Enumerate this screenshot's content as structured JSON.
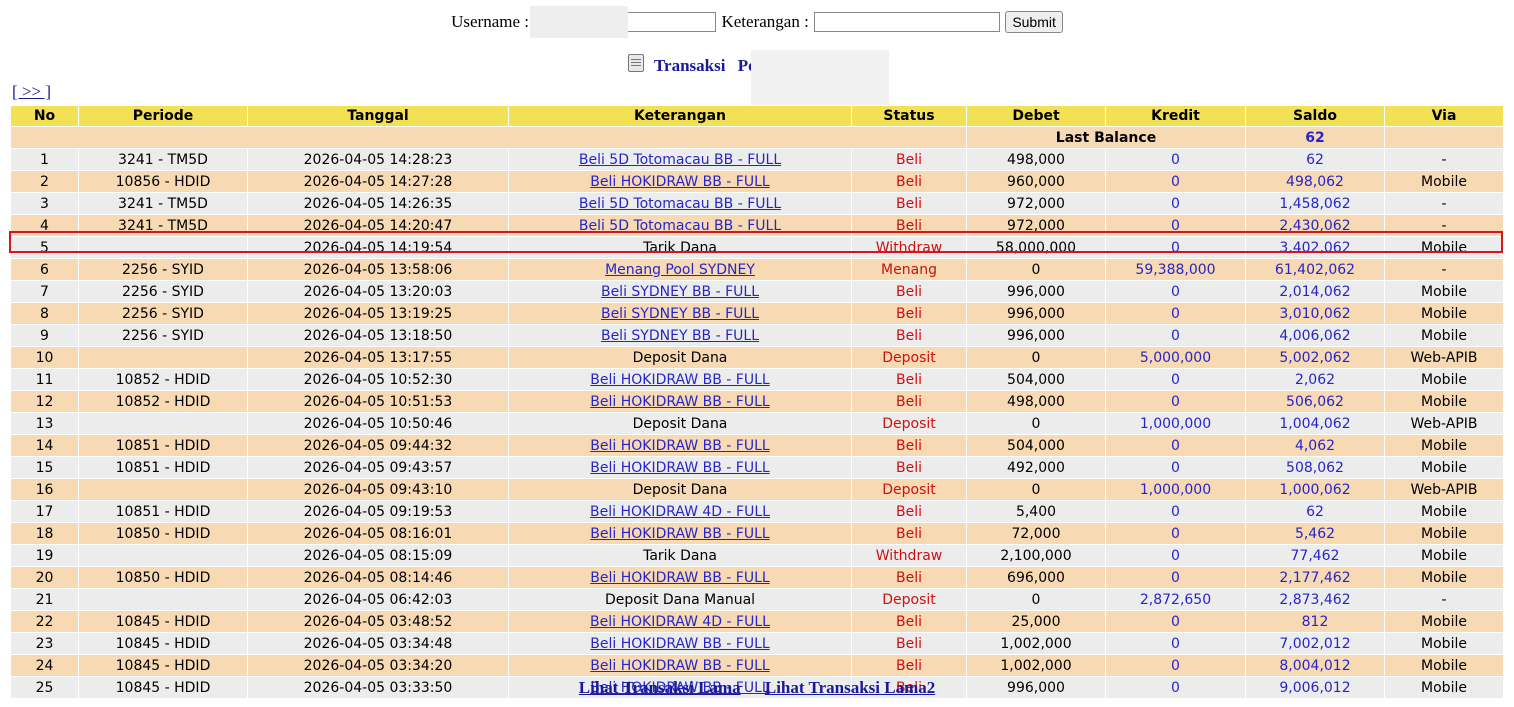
{
  "form": {
    "username_label": "Username :",
    "username_value": "",
    "keterangan_label": "Keterangan :",
    "keterangan_value": "",
    "submit_label": "Submit"
  },
  "title": {
    "transaksi": "Transaksi",
    "second": "Pe"
  },
  "nav": {
    "next": "[ >> ]"
  },
  "columns": [
    "No",
    "Periode",
    "Tanggal",
    "Keterangan",
    "Status",
    "Debet",
    "Kredit",
    "Saldo",
    "Via"
  ],
  "last_balance": {
    "label": "Last Balance",
    "value": "62"
  },
  "rows": [
    {
      "no": "1",
      "periode": "3241 - TM5D",
      "tanggal": "2026-04-05 14:28:23",
      "keterangan": "Beli 5D Totomacau BB - FULL",
      "link": true,
      "status": "Beli",
      "debet": "498,000",
      "kredit": "0",
      "saldo": "62",
      "via": "-"
    },
    {
      "no": "2",
      "periode": "10856 - HDID",
      "tanggal": "2026-04-05 14:27:28",
      "keterangan": "Beli HOKIDRAW BB - FULL",
      "link": true,
      "status": "Beli",
      "debet": "960,000",
      "kredit": "0",
      "saldo": "498,062",
      "via": "Mobile"
    },
    {
      "no": "3",
      "periode": "3241 - TM5D",
      "tanggal": "2026-04-05 14:26:35",
      "keterangan": "Beli 5D Totomacau BB - FULL",
      "link": true,
      "status": "Beli",
      "debet": "972,000",
      "kredit": "0",
      "saldo": "1,458,062",
      "via": "-"
    },
    {
      "no": "4",
      "periode": "3241 - TM5D",
      "tanggal": "2026-04-05 14:20:47",
      "keterangan": "Beli 5D Totomacau BB - FULL",
      "link": true,
      "status": "Beli",
      "debet": "972,000",
      "kredit": "0",
      "saldo": "2,430,062",
      "via": "-"
    },
    {
      "no": "5",
      "periode": "",
      "tanggal": "2026-04-05 14:19:54",
      "keterangan": "Tarik Dana",
      "link": false,
      "status": "Withdraw",
      "debet": "58,000,000",
      "kredit": "0",
      "saldo": "3,402,062",
      "via": "Mobile"
    },
    {
      "no": "6",
      "periode": "2256 - SYID",
      "tanggal": "2026-04-05 13:58:06",
      "keterangan": "Menang Pool SYDNEY",
      "link": true,
      "status": "Menang",
      "debet": "0",
      "kredit": "59,388,000",
      "saldo": "61,402,062",
      "via": "-"
    },
    {
      "no": "7",
      "periode": "2256 - SYID",
      "tanggal": "2026-04-05 13:20:03",
      "keterangan": "Beli SYDNEY BB - FULL",
      "link": true,
      "status": "Beli",
      "debet": "996,000",
      "kredit": "0",
      "saldo": "2,014,062",
      "via": "Mobile"
    },
    {
      "no": "8",
      "periode": "2256 - SYID",
      "tanggal": "2026-04-05 13:19:25",
      "keterangan": "Beli SYDNEY BB - FULL",
      "link": true,
      "status": "Beli",
      "debet": "996,000",
      "kredit": "0",
      "saldo": "3,010,062",
      "via": "Mobile"
    },
    {
      "no": "9",
      "periode": "2256 - SYID",
      "tanggal": "2026-04-05 13:18:50",
      "keterangan": "Beli SYDNEY BB - FULL",
      "link": true,
      "status": "Beli",
      "debet": "996,000",
      "kredit": "0",
      "saldo": "4,006,062",
      "via": "Mobile"
    },
    {
      "no": "10",
      "periode": "",
      "tanggal": "2026-04-05 13:17:55",
      "keterangan": "Deposit Dana",
      "link": false,
      "status": "Deposit",
      "debet": "0",
      "kredit": "5,000,000",
      "saldo": "5,002,062",
      "via": "Web-APIB"
    },
    {
      "no": "11",
      "periode": "10852 - HDID",
      "tanggal": "2026-04-05 10:52:30",
      "keterangan": "Beli HOKIDRAW BB - FULL",
      "link": true,
      "status": "Beli",
      "debet": "504,000",
      "kredit": "0",
      "saldo": "2,062",
      "via": "Mobile"
    },
    {
      "no": "12",
      "periode": "10852 - HDID",
      "tanggal": "2026-04-05 10:51:53",
      "keterangan": "Beli HOKIDRAW BB - FULL",
      "link": true,
      "status": "Beli",
      "debet": "498,000",
      "kredit": "0",
      "saldo": "506,062",
      "via": "Mobile"
    },
    {
      "no": "13",
      "periode": "",
      "tanggal": "2026-04-05 10:50:46",
      "keterangan": "Deposit Dana",
      "link": false,
      "status": "Deposit",
      "debet": "0",
      "kredit": "1,000,000",
      "saldo": "1,004,062",
      "via": "Web-APIB"
    },
    {
      "no": "14",
      "periode": "10851 - HDID",
      "tanggal": "2026-04-05 09:44:32",
      "keterangan": "Beli HOKIDRAW BB - FULL",
      "link": true,
      "status": "Beli",
      "debet": "504,000",
      "kredit": "0",
      "saldo": "4,062",
      "via": "Mobile"
    },
    {
      "no": "15",
      "periode": "10851 - HDID",
      "tanggal": "2026-04-05 09:43:57",
      "keterangan": "Beli HOKIDRAW BB - FULL",
      "link": true,
      "status": "Beli",
      "debet": "492,000",
      "kredit": "0",
      "saldo": "508,062",
      "via": "Mobile"
    },
    {
      "no": "16",
      "periode": "",
      "tanggal": "2026-04-05 09:43:10",
      "keterangan": "Deposit Dana",
      "link": false,
      "status": "Deposit",
      "debet": "0",
      "kredit": "1,000,000",
      "saldo": "1,000,062",
      "via": "Web-APIB"
    },
    {
      "no": "17",
      "periode": "10851 - HDID",
      "tanggal": "2026-04-05 09:19:53",
      "keterangan": "Beli HOKIDRAW 4D - FULL",
      "link": true,
      "status": "Beli",
      "debet": "5,400",
      "kredit": "0",
      "saldo": "62",
      "via": "Mobile"
    },
    {
      "no": "18",
      "periode": "10850 - HDID",
      "tanggal": "2026-04-05 08:16:01",
      "keterangan": "Beli HOKIDRAW BB - FULL",
      "link": true,
      "status": "Beli",
      "debet": "72,000",
      "kredit": "0",
      "saldo": "5,462",
      "via": "Mobile"
    },
    {
      "no": "19",
      "periode": "",
      "tanggal": "2026-04-05 08:15:09",
      "keterangan": "Tarik Dana",
      "link": false,
      "status": "Withdraw",
      "debet": "2,100,000",
      "kredit": "0",
      "saldo": "77,462",
      "via": "Mobile"
    },
    {
      "no": "20",
      "periode": "10850 - HDID",
      "tanggal": "2026-04-05 08:14:46",
      "keterangan": "Beli HOKIDRAW BB - FULL",
      "link": true,
      "status": "Beli",
      "debet": "696,000",
      "kredit": "0",
      "saldo": "2,177,462",
      "via": "Mobile"
    },
    {
      "no": "21",
      "periode": "",
      "tanggal": "2026-04-05 06:42:03",
      "keterangan": "Deposit Dana Manual",
      "link": false,
      "status": "Deposit",
      "debet": "0",
      "kredit": "2,872,650",
      "saldo": "2,873,462",
      "via": "-"
    },
    {
      "no": "22",
      "periode": "10845 - HDID",
      "tanggal": "2026-04-05 03:48:52",
      "keterangan": "Beli HOKIDRAW 4D - FULL",
      "link": true,
      "status": "Beli",
      "debet": "25,000",
      "kredit": "0",
      "saldo": "812",
      "via": "Mobile"
    },
    {
      "no": "23",
      "periode": "10845 - HDID",
      "tanggal": "2026-04-05 03:34:48",
      "keterangan": "Beli HOKIDRAW BB - FULL",
      "link": true,
      "status": "Beli",
      "debet": "1,002,000",
      "kredit": "0",
      "saldo": "7,002,012",
      "via": "Mobile"
    },
    {
      "no": "24",
      "periode": "10845 - HDID",
      "tanggal": "2026-04-05 03:34:20",
      "keterangan": "Beli HOKIDRAW BB - FULL",
      "link": true,
      "status": "Beli",
      "debet": "1,002,000",
      "kredit": "0",
      "saldo": "8,004,012",
      "via": "Mobile"
    },
    {
      "no": "25",
      "periode": "10845 - HDID",
      "tanggal": "2026-04-05 03:33:50",
      "keterangan": "Beli HOKIDRAW BB - FULL",
      "link": true,
      "status": "Beli",
      "debet": "996,000",
      "kredit": "0",
      "saldo": "9,006,012",
      "via": "Mobile"
    }
  ],
  "footer": {
    "link1": "Lihat Transaksi Lama",
    "link2": "Lihat Transaksi Lama2"
  },
  "colors": {
    "header_bg": "#f3e155",
    "row_even": "#f7d9b3",
    "row_odd": "#ececec",
    "status_red": "#cc1111",
    "link_blue": "#2626c8",
    "highlight_border": "#d8141c"
  },
  "icons": {
    "title_icon": "clipboard-icon"
  }
}
